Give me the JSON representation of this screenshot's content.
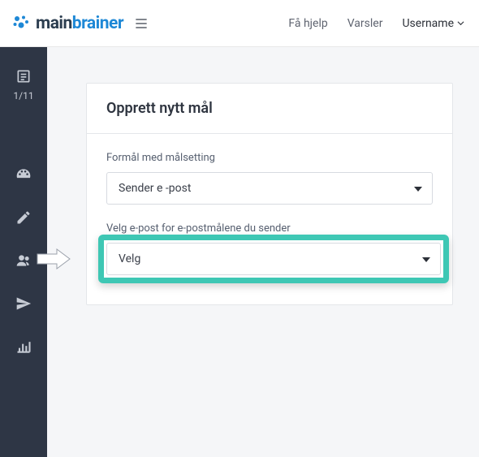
{
  "header": {
    "logo_main": "main",
    "logo_brainer": "brainer",
    "nav": {
      "help": "Få hjelp",
      "alerts": "Varsler",
      "username": "Username"
    }
  },
  "sidebar": {
    "step_counter": "1/11"
  },
  "card": {
    "title": "Opprett nytt mål",
    "purpose": {
      "label": "Formål med målsetting",
      "value": "Sender e -post"
    },
    "email_select": {
      "label": "Velg e-post for e-postmålene du sender",
      "value": "Velg"
    }
  }
}
